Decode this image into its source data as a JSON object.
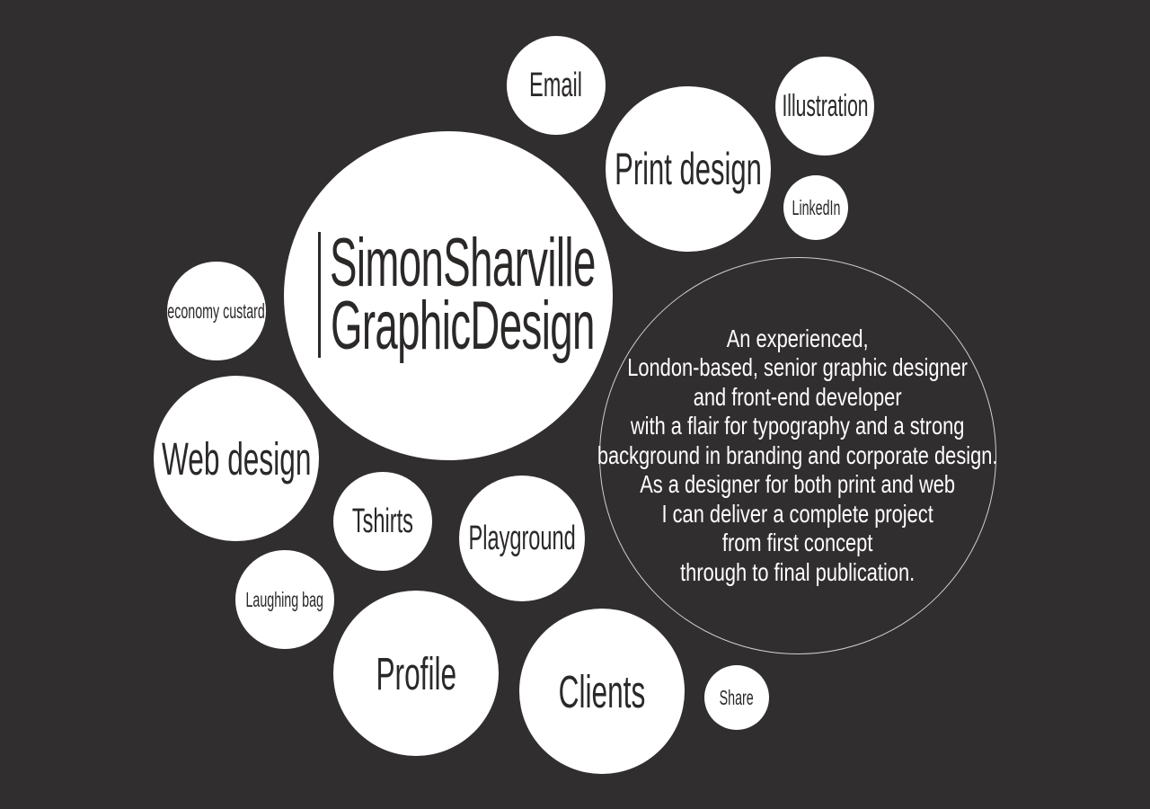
{
  "brand": {
    "line1": "SimonSharville",
    "line2": "GraphicDesign"
  },
  "nav": {
    "email": "Email",
    "print_design": "Print design",
    "illustration": "Illustration",
    "linkedin": "LinkedIn",
    "economy_custard": "economy custard",
    "web_design": "Web design",
    "tshirts": "Tshirts",
    "playground": "Playground",
    "laughing_bag": "Laughing bag",
    "profile": "Profile",
    "clients": "Clients",
    "share": "Share"
  },
  "about": {
    "lines": [
      "An experienced,",
      "London-based, senior graphic designer",
      "and front-end developer",
      "with a flair for typography and a strong",
      "background in branding and corporate design.",
      "As a designer for both print and web",
      "I can deliver a complete project",
      "from first concept",
      "through to final publication."
    ]
  },
  "colors": {
    "background": "#312e2f",
    "bubble": "#ffffff",
    "text_dark": "#2b2828",
    "text_light": "#ffffff"
  }
}
